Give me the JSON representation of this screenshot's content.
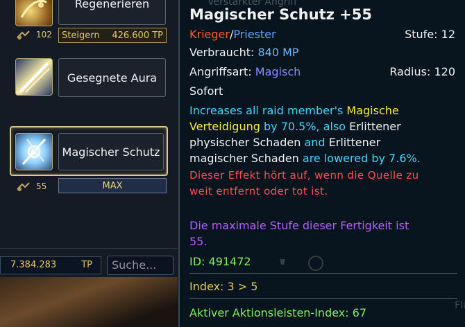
{
  "skills": [
    {
      "name": "Regenerieren",
      "level": "102",
      "button": "Steigern",
      "tp": "426.600 TP"
    },
    {
      "name": "Gesegnete Aura"
    },
    {
      "name": "Magischer Schutz",
      "level": "55",
      "status": "MAX"
    }
  ],
  "footer": {
    "tp_value": "7.384.283",
    "tp_label": "TP",
    "search_placeholder": "Suche..."
  },
  "tooltip": {
    "faded_header": "Verstärkter Angriff",
    "title": "Magischer Schutz +55",
    "class1": "Krieger",
    "slash": "/",
    "class2": "Priester",
    "level_label": "Stufe: 12",
    "consumed_label": "Verbraucht:",
    "consumed_value": "840 MP",
    "attack_label": "Angriffsart:",
    "attack_value": "Magisch",
    "radius_label": "Radius: 120",
    "cast": "Sofort",
    "desc1a": "Increases all raid member's ",
    "desc1b": "Magische",
    "desc2a": "Verteidigung",
    "desc2b": " by 70.5%, also ",
    "desc2c": "Erlittener",
    "desc3a": "physischer Schaden",
    "desc3b": " and ",
    "desc3c": "Erlittener",
    "desc4a": "magischer Schaden",
    "desc4b": " are lowered by 7.6%.",
    "warn1": "Dieser Effekt hört auf, wenn die Quelle zu",
    "warn2": "weit entfernt oder tot ist.",
    "max1": "Die maximale Stufe dieser Fertigkeit ist",
    "max2": "55.",
    "id": "ID: 491472",
    "index": "Index: 3 > 5",
    "action_index": "Aktiver Aktionsleisten-Index: 67",
    "faded_right": "Flü"
  },
  "colors": {
    "white": "#f1f1f1",
    "krieger": "#ff5a2a",
    "priester": "#5aa6ff",
    "mp": "#6ab4ff",
    "magisch": "#8c8cff",
    "cyan": "#3fd4ff",
    "yellow": "#ffea33",
    "warn": "#ff4d4d",
    "purple": "#b55cff",
    "green": "#7fef5a",
    "index": "#e6c85a"
  }
}
